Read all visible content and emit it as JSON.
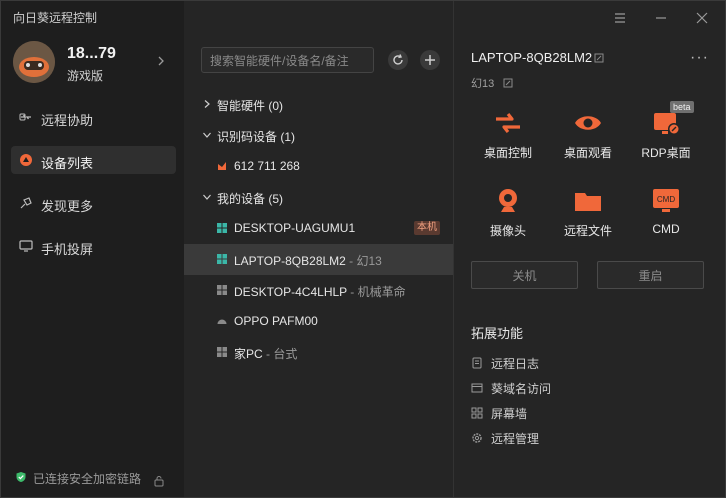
{
  "app": {
    "title": "向日葵远程控制"
  },
  "profile": {
    "name": "18...79",
    "plan": "游戏版"
  },
  "nav": [
    {
      "label": "远程协助",
      "icon": "remote-assist-icon"
    },
    {
      "label": "设备列表",
      "icon": "device-list-icon"
    },
    {
      "label": "发现更多",
      "icon": "discover-icon"
    },
    {
      "label": "手机投屏",
      "icon": "phone-cast-icon"
    }
  ],
  "status": {
    "secure_text": "已连接安全加密链路"
  },
  "search": {
    "placeholder": "搜索智能硬件/设备名/备注"
  },
  "tree": {
    "groups": [
      {
        "label": "智能硬件 (0)"
      },
      {
        "label": "识别码设备 (1)"
      },
      {
        "label": "我的设备 (5)"
      }
    ],
    "id_devices": [
      {
        "name": "612 711 268"
      }
    ],
    "my_devices": [
      {
        "name": "DESKTOP-UAGUMU1",
        "note": "",
        "badge": "本机"
      },
      {
        "name": "LAPTOP-8QB28LM2",
        "note": " - 幻13"
      },
      {
        "name": "DESKTOP-4C4LHLP",
        "note": " - 机械革命"
      },
      {
        "name": "OPPO PAFM00",
        "note": ""
      },
      {
        "name": "家PC",
        "note": " - 台式"
      }
    ]
  },
  "detail": {
    "device_name": "LAPTOP-8QB28LM2",
    "remark": "幻13",
    "features": [
      {
        "label": "桌面控制",
        "icon": "desktop-control-icon"
      },
      {
        "label": "桌面观看",
        "icon": "eye-icon"
      },
      {
        "label": "RDP桌面",
        "icon": "rdp-icon",
        "badge": "beta"
      },
      {
        "label": "摄像头",
        "icon": "camera-icon"
      },
      {
        "label": "远程文件",
        "icon": "folder-icon"
      },
      {
        "label": "CMD",
        "icon": "cmd-icon",
        "icon_text": "CMD"
      }
    ],
    "shutdown_label": "关机",
    "restart_label": "重启",
    "extensions_title": "拓展功能",
    "extensions": [
      {
        "label": "远程日志",
        "icon": "log-icon"
      },
      {
        "label": "葵域名访问",
        "icon": "browser-icon"
      },
      {
        "label": "屏幕墙",
        "icon": "screen-wall-icon"
      },
      {
        "label": "远程管理",
        "icon": "gear-icon"
      }
    ]
  },
  "colors": {
    "accent": "#f0683a",
    "sidebar_bg": "#1e1e1e",
    "panel_bg": "#252525",
    "selected_row": "#3a3a3a"
  }
}
